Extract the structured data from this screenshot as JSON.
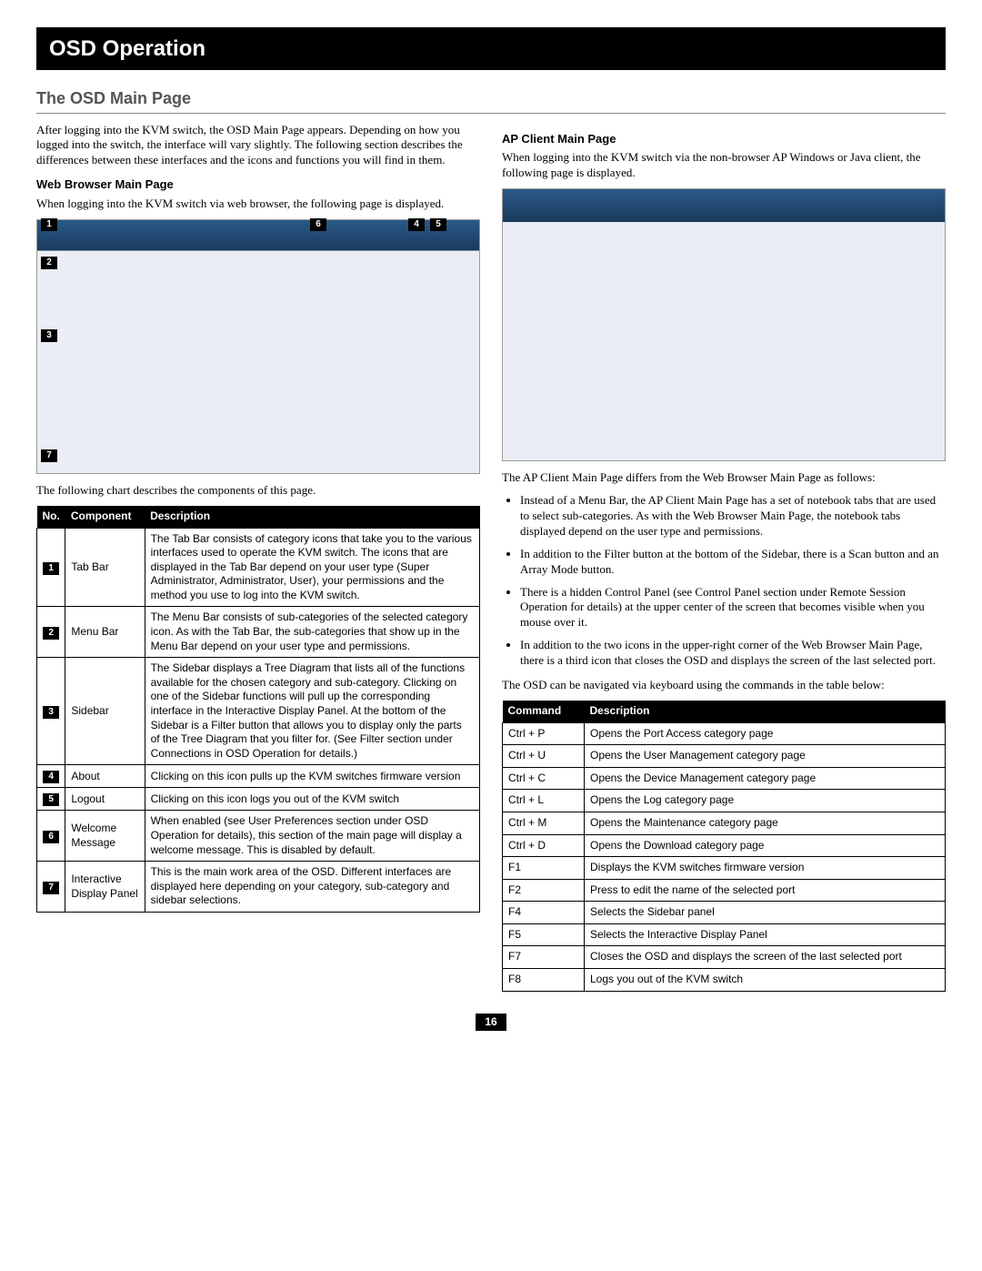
{
  "chapter_title": "OSD Operation",
  "section_title": "The OSD Main Page",
  "intro_para": "After logging into the KVM switch, the OSD Main Page appears. Depending on how you logged into the switch, the interface will vary slightly. The following section describes the differences between these interfaces and the icons and functions you will find in them.",
  "web_browser": {
    "heading": "Web Browser Main Page",
    "para": "When logging into the KVM switch via web browser, the following page is displayed.",
    "chart_intro": "The following chart describes the components of this page.",
    "callouts": [
      "1",
      "2",
      "3",
      "4",
      "5",
      "6",
      "7"
    ]
  },
  "components_table": {
    "headers": [
      "No.",
      "Component",
      "Description"
    ],
    "rows": [
      {
        "no": "1",
        "component": "Tab Bar",
        "desc": "The Tab Bar consists of category icons that take you to the various interfaces used to operate the KVM switch. The icons that are displayed in the Tab Bar depend on your user type (Super Administrator, Administrator, User), your permissions and the method you use to log into the KVM switch."
      },
      {
        "no": "2",
        "component": "Menu Bar",
        "desc": "The Menu Bar consists of sub-categories of the selected category icon. As with the Tab Bar, the sub-categories that show up in the Menu Bar depend on your user type and permissions."
      },
      {
        "no": "3",
        "component": "Sidebar",
        "desc": "The Sidebar displays a Tree Diagram that lists all of the functions available for the chosen category and sub-category. Clicking on one of the Sidebar functions will pull up the corresponding interface in the Interactive Display Panel. At the bottom of the Sidebar is a Filter button that allows you to display only the parts of the Tree Diagram that you filter for. (See Filter section under Connections in OSD Operation for details.)"
      },
      {
        "no": "4",
        "component": "About",
        "desc": "Clicking on this icon pulls up the KVM switches firmware version"
      },
      {
        "no": "5",
        "component": "Logout",
        "desc": "Clicking on this icon logs you out of the KVM switch"
      },
      {
        "no": "6",
        "component": "Welcome Message",
        "desc": "When enabled (see User Preferences section under OSD Operation for details), this section of the main page will display a welcome message. This is disabled by default."
      },
      {
        "no": "7",
        "component": "Interactive Display Panel",
        "desc": "This is the main work area of the OSD. Different interfaces are displayed here depending on your category, sub-category and sidebar selections."
      }
    ]
  },
  "ap_client": {
    "heading": "AP Client Main Page",
    "para": "When logging into the KVM switch via the non-browser AP Windows or Java client, the following page is displayed.",
    "diff_intro": "The AP Client Main Page differs from the Web Browser Main Page as follows:",
    "bullets": [
      "Instead of a Menu Bar, the AP Client Main Page has a set of notebook tabs that are used to select sub-categories. As with the Web Browser Main Page, the notebook tabs displayed depend on the user type and permissions.",
      "In addition to the Filter button at the bottom of the Sidebar, there is a Scan button and an Array Mode button.",
      "There is a hidden Control Panel (see Control Panel section under Remote Session Operation for details) at the upper center of the screen that becomes visible when you mouse over it.",
      "In addition to the two icons in the upper-right corner of the Web Browser Main Page, there is a third icon that closes the OSD and displays the screen of the last selected port."
    ],
    "keyboard_intro": "The OSD can be navigated via keyboard using the commands in the table below:"
  },
  "commands_table": {
    "headers": [
      "Command",
      "Description"
    ],
    "rows": [
      {
        "cmd": "Ctrl + P",
        "desc": "Opens the Port Access category page"
      },
      {
        "cmd": "Ctrl + U",
        "desc": "Opens the User Management category page"
      },
      {
        "cmd": "Ctrl + C",
        "desc": "Opens the Device Management category page"
      },
      {
        "cmd": "Ctrl + L",
        "desc": "Opens the Log category page"
      },
      {
        "cmd": "Ctrl + M",
        "desc": "Opens the Maintenance category page"
      },
      {
        "cmd": "Ctrl + D",
        "desc": "Opens the Download category page"
      },
      {
        "cmd": "F1",
        "desc": "Displays the KVM switches firmware version"
      },
      {
        "cmd": "F2",
        "desc": "Press to edit the name of the selected port"
      },
      {
        "cmd": "F4",
        "desc": "Selects the Sidebar panel"
      },
      {
        "cmd": "F5",
        "desc": "Selects the Interactive Display Panel"
      },
      {
        "cmd": "F7",
        "desc": "Closes the OSD and displays the screen of the last selected port"
      },
      {
        "cmd": "F8",
        "desc": "Logs you out of the KVM switch"
      }
    ]
  },
  "page_number": "16"
}
